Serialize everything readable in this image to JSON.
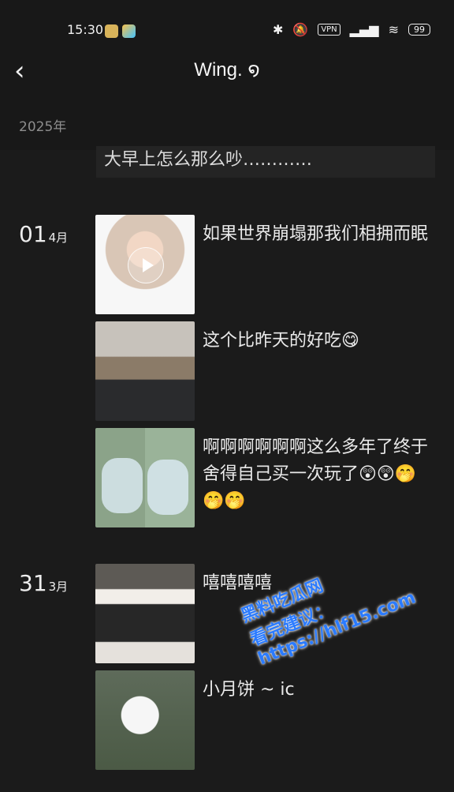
{
  "status_bar": {
    "time": "15:30",
    "vpn": "VPN",
    "battery": "99"
  },
  "header": {
    "title": "Wing. ໑",
    "back_icon": "back-chevron-icon"
  },
  "year": "2025年",
  "top_note": "大早上怎么那么吵…………",
  "dates": [
    {
      "day": "01",
      "month": "4月"
    },
    {
      "day": "31",
      "month": "3月"
    }
  ],
  "posts": [
    {
      "caption": "如果世界崩塌那我们相拥而眠"
    },
    {
      "caption": "这个比昨天的好吃😋"
    },
    {
      "caption": "啊啊啊啊啊啊这么多年了终于舍得自己买一次玩了😲😲🤭🤭🤭"
    },
    {
      "caption": "嘻嘻嘻嘻"
    },
    {
      "caption": "小月饼 ~ ic"
    }
  ],
  "watermark": {
    "brand": "黑料吃瓜网",
    "line": "看完建议：https://hlf15.com"
  }
}
